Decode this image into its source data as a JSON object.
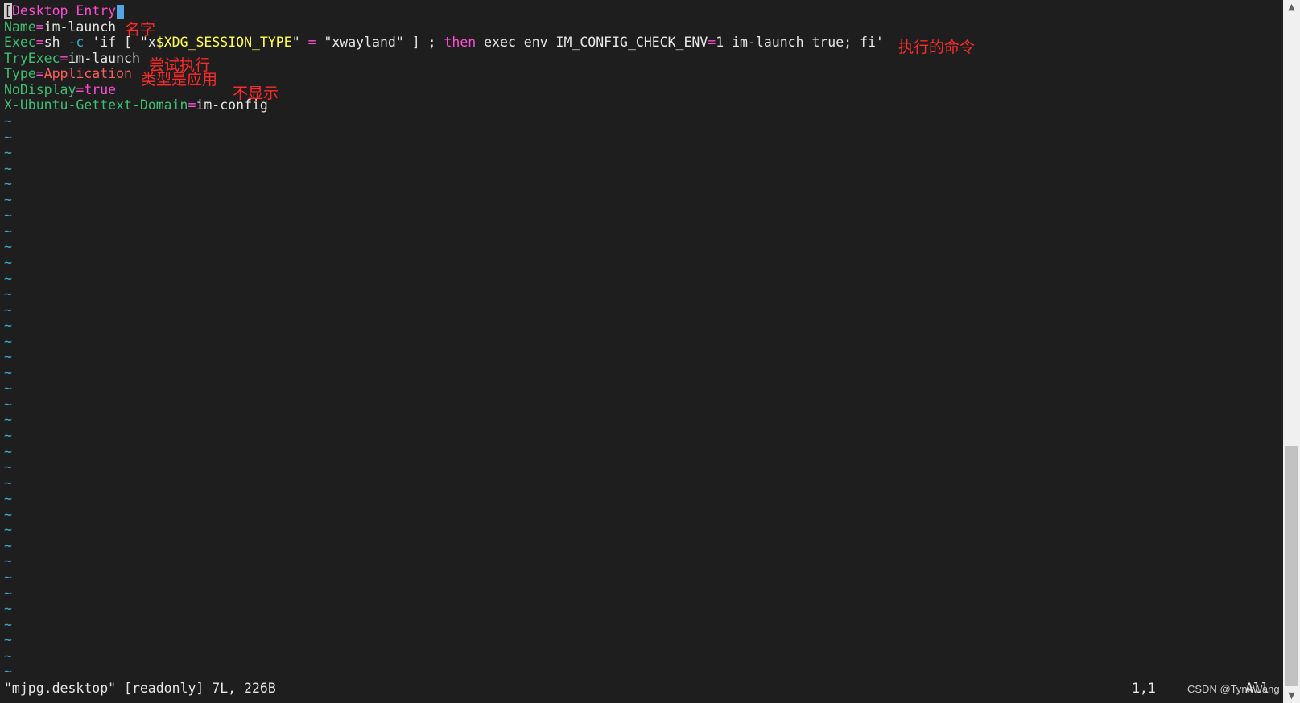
{
  "editor": {
    "header_open": "[",
    "header_name": "Desktop Entry",
    "lines": {
      "name_key": "Name",
      "name_val": "im-launch",
      "exec_key": "Exec",
      "exec_cmd": "sh",
      "exec_flag": "-c",
      "exec_q1": "'if [ \"x",
      "exec_var": "$XDG_SESSION_TYPE",
      "exec_q2": "\" ",
      "exec_eq": "=",
      "exec_q3": " \"xwayland\" ] ; ",
      "exec_then": "then",
      "exec_rest": " exec env IM_CONFIG_CHECK_ENV",
      "exec_eq2": "=",
      "exec_rest2": "1 im-launch true; fi'",
      "tryexec_key": "TryExec",
      "tryexec_val": "im-launch",
      "type_key": "Type",
      "type_val": "Application",
      "nodisplay_key": "NoDisplay",
      "nodisplay_val": "true",
      "domain_key": "X-Ubuntu-Gettext-Domain",
      "domain_val": "im-config"
    },
    "equals": "=",
    "tilde": "~"
  },
  "annotations": {
    "name": "名字",
    "exec": "执行的命令",
    "tryexec": "尝试执行",
    "type": "类型是应用",
    "nodisplay": "不显示"
  },
  "status": {
    "file_info": "\"mjpg.desktop\" [readonly] 7L, 226B",
    "position": "1,1",
    "scroll": "All"
  },
  "watermark": "CSDN @TynxWang",
  "colors": {
    "background": "#1e1e1e",
    "key": "#3fbf73",
    "equals": "#ff4fd0",
    "header": "#ff4fd0",
    "string": "#ffff55",
    "keyword": "#ff4fd0",
    "type_value": "#ff5f5f",
    "annotation": "#ff2a2a",
    "tilde": "#3fa7c9"
  }
}
